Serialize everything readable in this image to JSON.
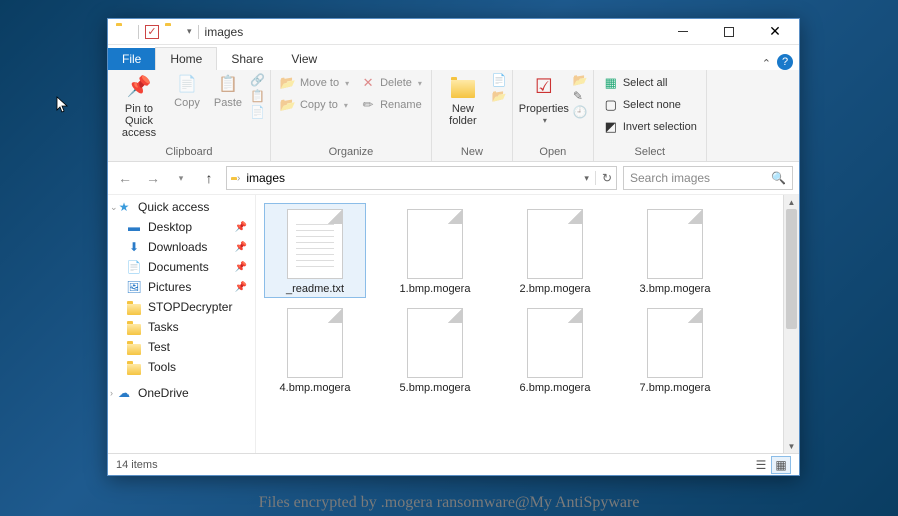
{
  "titlebar": {
    "title": "images"
  },
  "tabs": {
    "file": "File",
    "home": "Home",
    "share": "Share",
    "view": "View"
  },
  "ribbon": {
    "clipboard": {
      "label": "Clipboard",
      "pin": "Pin to Quick access",
      "copy": "Copy",
      "paste": "Paste"
    },
    "organize": {
      "label": "Organize",
      "moveto": "Move to",
      "copyto": "Copy to",
      "delete": "Delete",
      "rename": "Rename"
    },
    "new": {
      "label": "New",
      "newfolder": "New folder"
    },
    "open": {
      "label": "Open",
      "properties": "Properties"
    },
    "select": {
      "label": "Select",
      "all": "Select all",
      "none": "Select none",
      "invert": "Invert selection"
    }
  },
  "address": {
    "path": "images"
  },
  "search": {
    "placeholder": "Search images"
  },
  "nav": {
    "quick": "Quick access",
    "desktop": "Desktop",
    "downloads": "Downloads",
    "documents": "Documents",
    "pictures": "Pictures",
    "stop": "STOPDecrypter",
    "tasks": "Tasks",
    "test": "Test",
    "tools": "Tools",
    "onedrive": "OneDrive"
  },
  "files": [
    {
      "name": "_readme.txt",
      "type": "txt",
      "selected": true
    },
    {
      "name": "1.bmp.mogera",
      "type": "unk"
    },
    {
      "name": "2.bmp.mogera",
      "type": "unk"
    },
    {
      "name": "3.bmp.mogera",
      "type": "unk"
    },
    {
      "name": "4.bmp.mogera",
      "type": "unk"
    },
    {
      "name": "5.bmp.mogera",
      "type": "unk"
    },
    {
      "name": "6.bmp.mogera",
      "type": "unk"
    },
    {
      "name": "7.bmp.mogera",
      "type": "unk"
    }
  ],
  "status": {
    "count": "14 items"
  },
  "caption": "Files encrypted by .mogera ransomware@My AntiSpyware"
}
